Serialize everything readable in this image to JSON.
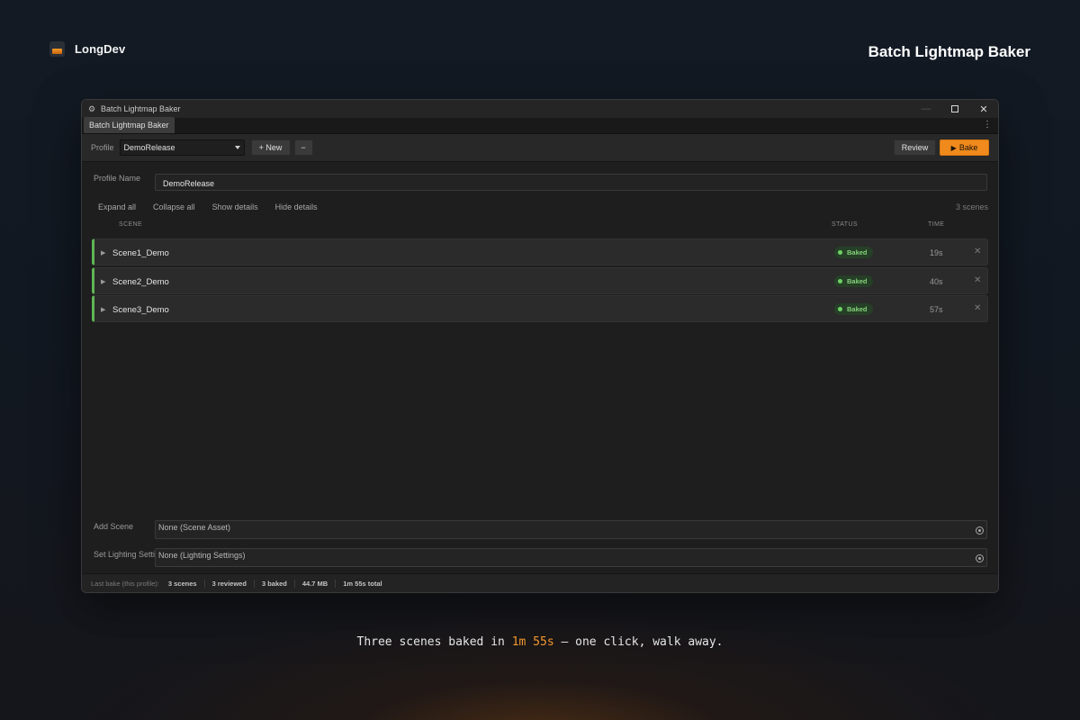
{
  "brand": {
    "name": "LongDev"
  },
  "page_heading": "Batch Lightmap Baker",
  "window": {
    "title": "Batch Lightmap Baker",
    "tab": "Batch Lightmap Baker"
  },
  "toolbar": {
    "profile_label": "Profile",
    "profile_value": "DemoRelease",
    "new_label": "+ New",
    "minus_label": "−",
    "review_label": "Review",
    "bake_label": "Bake",
    "accent_color": "#f08a1c"
  },
  "profile_name": {
    "label": "Profile Name",
    "value": "DemoRelease"
  },
  "actions": [
    "Expand all",
    "Collapse all",
    "Show details",
    "Hide details"
  ],
  "scene_count": "3 scenes",
  "columns": {
    "scene": "SCENE",
    "status": "STATUS",
    "time": "TIME"
  },
  "scenes": [
    {
      "name": "Scene1_Demo",
      "status": "Baked",
      "time": "19s"
    },
    {
      "name": "Scene2_Demo",
      "status": "Baked",
      "time": "40s"
    },
    {
      "name": "Scene3_Demo",
      "status": "Baked",
      "time": "57s"
    }
  ],
  "status_color": "#5fb655",
  "add_scene": {
    "label": "Add Scene",
    "value": "None (Scene Asset)"
  },
  "lighting": {
    "label": "Set Lighting Settings",
    "value": "None (Lighting Settings)"
  },
  "statusbar": {
    "lead": "Last bake (this profile):",
    "scenes": "3 scenes",
    "reviewed": "3 reviewed",
    "baked": "3 baked",
    "size": "44.7 MB",
    "total": "1m 55s total"
  },
  "caption": {
    "before": "Three scenes baked in ",
    "highlight": "1m 55s",
    "after": " — one click, walk away."
  }
}
